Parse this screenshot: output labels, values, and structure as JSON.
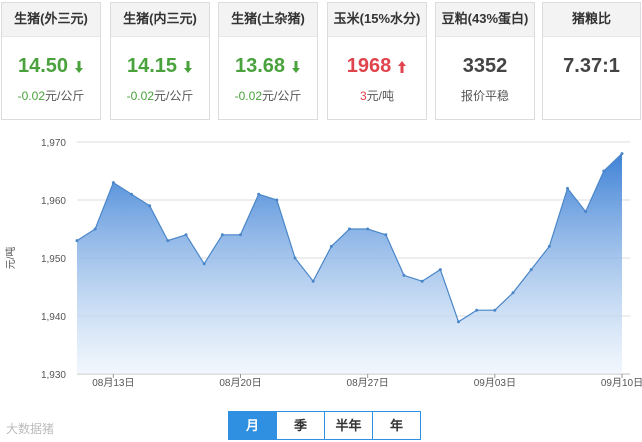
{
  "cards": [
    {
      "title": "生猪(外三元)",
      "price": "14.50",
      "direction": "down",
      "change": "-0.02",
      "unit": "元/公斤"
    },
    {
      "title": "生猪(内三元)",
      "price": "14.15",
      "direction": "down",
      "change": "-0.02",
      "unit": "元/公斤"
    },
    {
      "title": "生猪(土杂猪)",
      "price": "13.68",
      "direction": "down",
      "change": "-0.02",
      "unit": "元/公斤"
    },
    {
      "title": "玉米(15%水分)",
      "price": "1968",
      "direction": "up",
      "change": "3",
      "unit": "元/吨"
    },
    {
      "title": "豆粕(43%蛋白)",
      "price": "3352",
      "direction": "none",
      "sub": "报价平稳"
    },
    {
      "title": "猪粮比",
      "price": "7.37:1"
    }
  ],
  "chart_data": {
    "type": "area",
    "ylabel": "元/吨",
    "ylim": [
      1930,
      1970
    ],
    "yticks": [
      "1,930",
      "1,940",
      "1,950",
      "1,960",
      "1,970"
    ],
    "xticks": [
      "08月13日",
      "08月20日",
      "08月27日",
      "09月03日",
      "09月10日"
    ],
    "grid": true,
    "series": [
      {
        "values": [
          1953,
          1955,
          1963,
          1961,
          1959,
          1953,
          1954,
          1949,
          1954,
          1954,
          1961,
          1960,
          1950,
          1946,
          1952,
          1955,
          1955,
          1954,
          1947,
          1946,
          1948,
          1939,
          1941,
          1941,
          1944,
          1948,
          1952,
          1962,
          1958,
          1965,
          1968
        ]
      }
    ],
    "colors": {
      "line": "#4a86c8",
      "fill_top": "#3f82d6",
      "fill_bottom": "#e8f1fb"
    }
  },
  "range_tabs": [
    "月",
    "季",
    "半年",
    "年"
  ],
  "active_tab": "月",
  "watermark": "大数据猪"
}
